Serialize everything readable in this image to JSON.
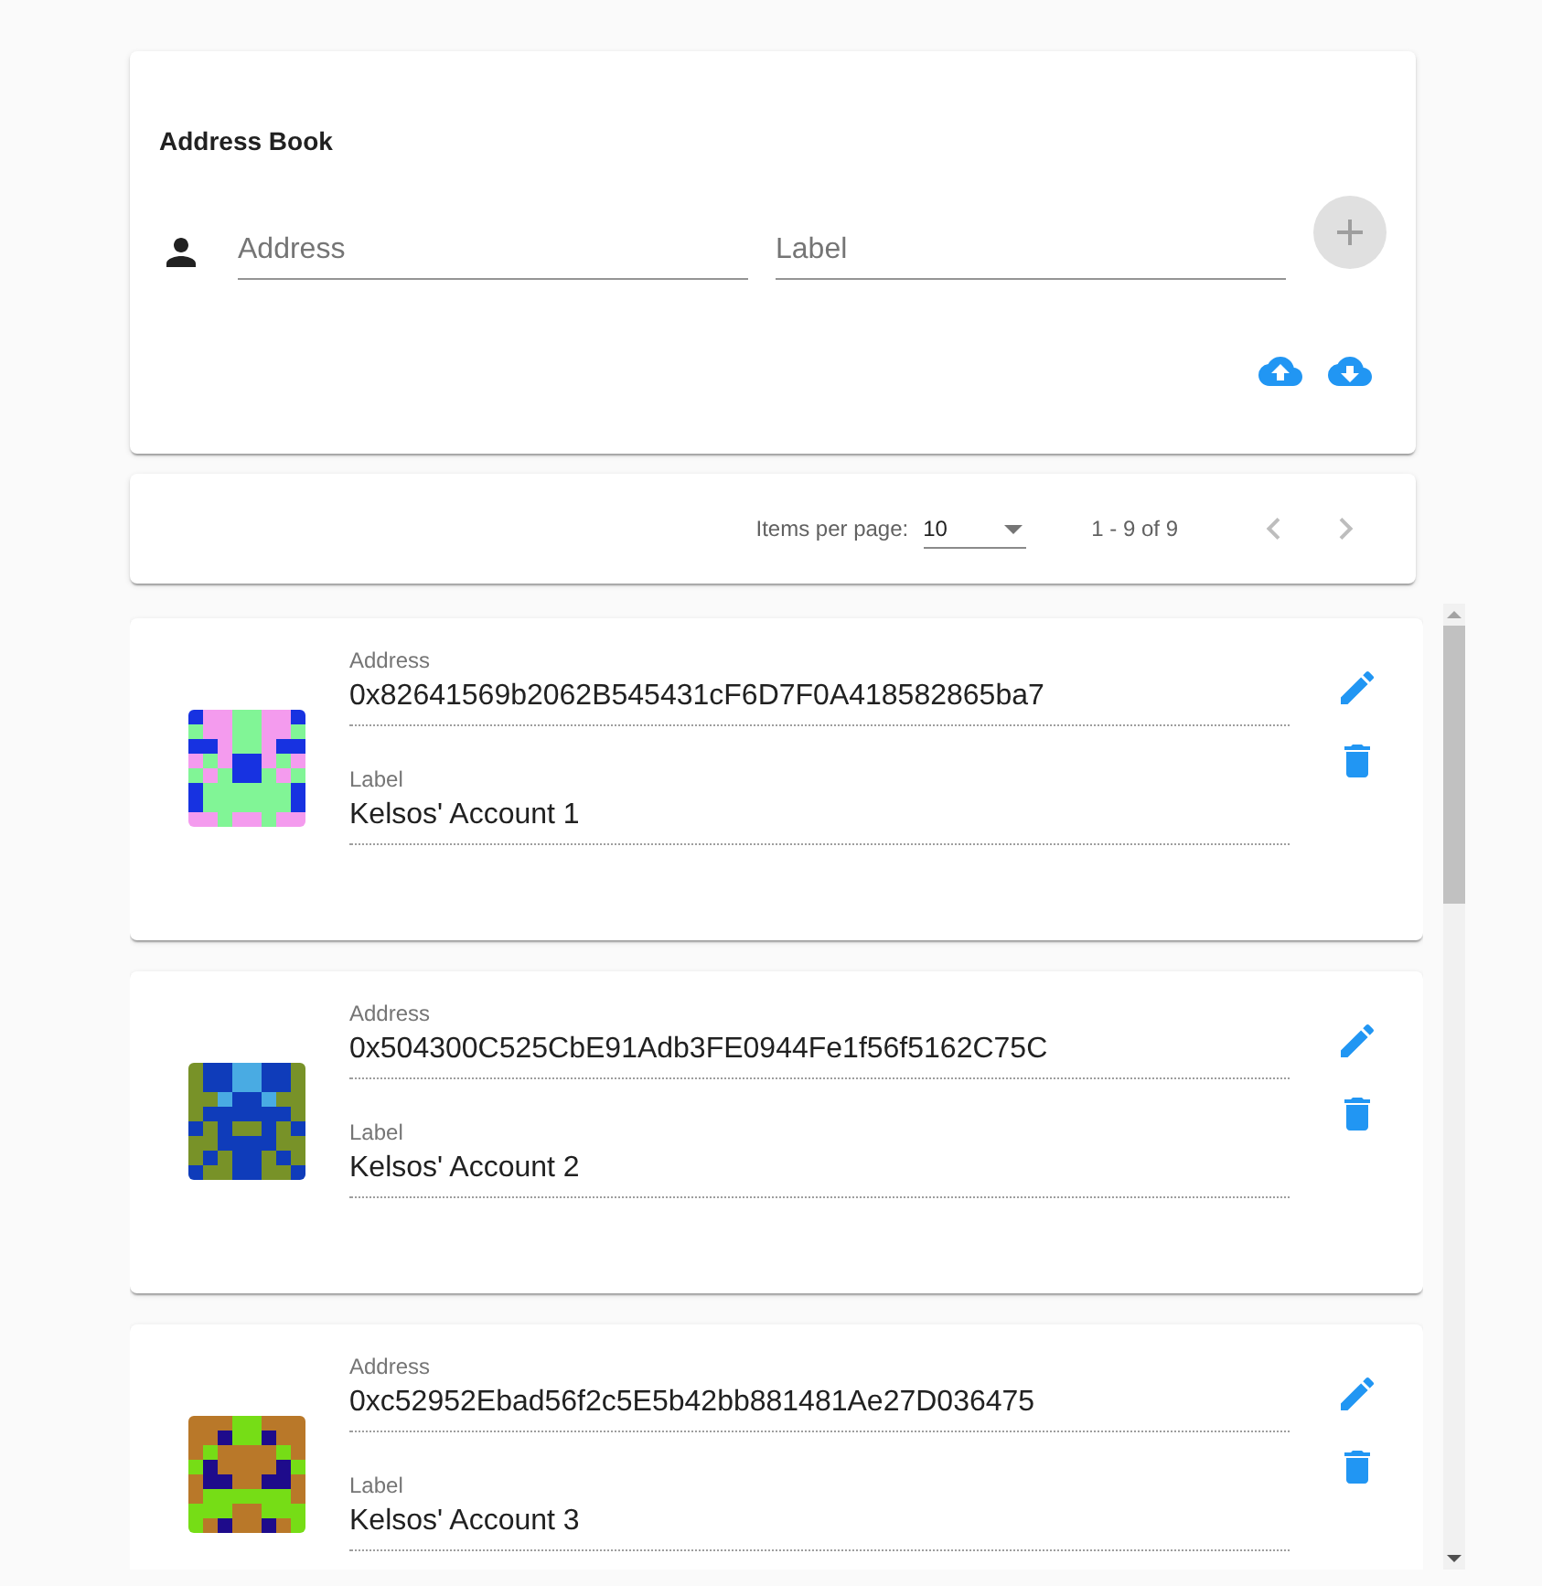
{
  "header": {
    "title": "Address Book"
  },
  "form": {
    "address_placeholder": "Address",
    "label_placeholder": "Label",
    "add_disabled": true
  },
  "paginator": {
    "items_per_page_label": "Items per page:",
    "page_size": "10",
    "range": "1 - 9 of 9",
    "prev_disabled": true,
    "next_disabled": true
  },
  "entries": [
    {
      "address_caption": "Address",
      "address": "0x82641569b2062B545431cF6D7F0A418582865ba7",
      "label_caption": "Label",
      "label": "Kelsos' Account 1"
    },
    {
      "address_caption": "Address",
      "address": "0x504300C525CbE91Adb3FE0944Fe1f56f5162C75C",
      "label_caption": "Label",
      "label": "Kelsos' Account 2"
    },
    {
      "address_caption": "Address",
      "address": "0xc52952Ebad56f2c5E5b42bb881481Ae27D036475",
      "label_caption": "Label",
      "label": "Kelsos' Account 3"
    }
  ]
}
